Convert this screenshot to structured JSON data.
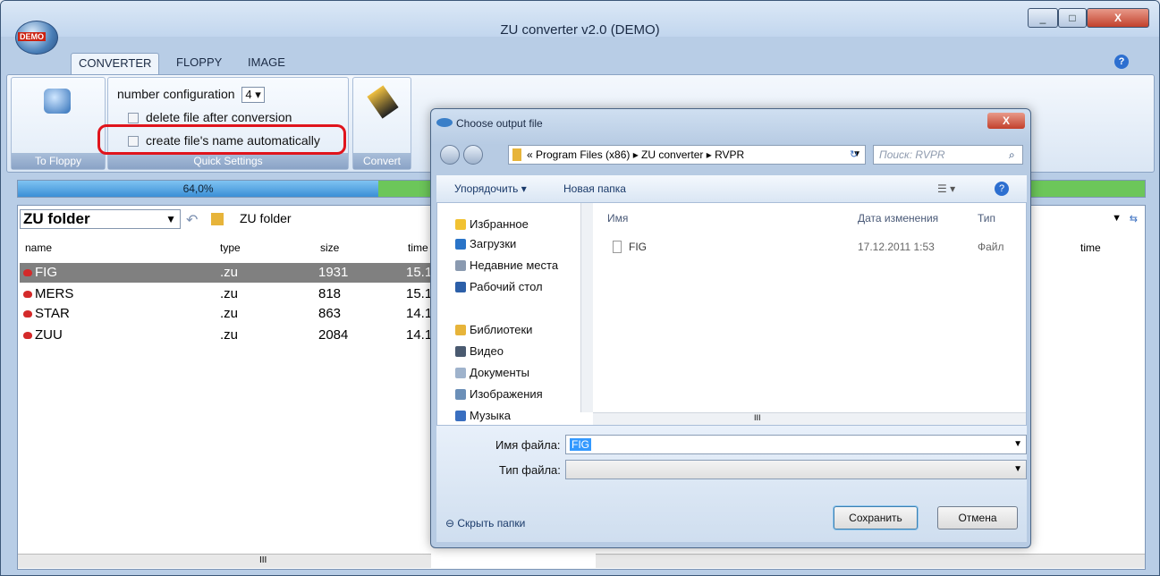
{
  "window": {
    "title": "ZU converter v2.0 (DEMO)",
    "orb_badge": "DEMO",
    "min": "_",
    "max": "□",
    "close": "X"
  },
  "tabs": [
    "CONVERTER",
    "FLOPPY",
    "IMAGE"
  ],
  "help": "?",
  "ribbon": {
    "to_floppy_label": "To Floppy",
    "quick_settings_label": "Quick Settings",
    "convert_label": "Convert",
    "number_config_label": "number configuration",
    "number_config_value": "4",
    "delete_file_label": "delete file after conversion",
    "auto_name_label": "create file's name automatically"
  },
  "progress": {
    "text": "64,0%",
    "value": 0.64
  },
  "left_panel": {
    "folder_combo": "ZU folder",
    "path": "ZU folder",
    "columns": [
      "name",
      "type",
      "size",
      "time"
    ],
    "rows": [
      {
        "name": "FIG",
        "type": ".zu",
        "size": "1931",
        "time": "15.1"
      },
      {
        "name": "MERS",
        "type": ".zu",
        "size": "818",
        "time": "15.1"
      },
      {
        "name": "STAR",
        "type": ".zu",
        "size": "863",
        "time": "14.1"
      },
      {
        "name": "ZUU",
        "type": ".zu",
        "size": "2084",
        "time": "14.1"
      }
    ],
    "right_col": "time",
    "scroll_mark": "III"
  },
  "dialog": {
    "title": "Choose output file",
    "address": "« Program Files (x86) ▸ ZU converter ▸ RVPR",
    "search_placeholder": "Поиск: RVPR",
    "organize": "Упорядочить ▾",
    "new_folder": "Новая папка",
    "nav_items": [
      "Избранное",
      "Загрузки",
      "Недавние места",
      "Рабочий стол",
      "Библиотеки",
      "Видео",
      "Документы",
      "Изображения",
      "Музыка"
    ],
    "col_name": "Имя",
    "col_date": "Дата изменения",
    "col_type": "Тип",
    "file_name": "FIG",
    "file_date": "17.12.2011 1:53",
    "file_type": "Файл",
    "filename_label": "Имя файла:",
    "filename_value": "FIG",
    "filetype_label": "Тип файла:",
    "hide_folders": "Скрыть папки",
    "save": "Сохранить",
    "cancel": "Отмена",
    "scroll_mark": "III"
  }
}
